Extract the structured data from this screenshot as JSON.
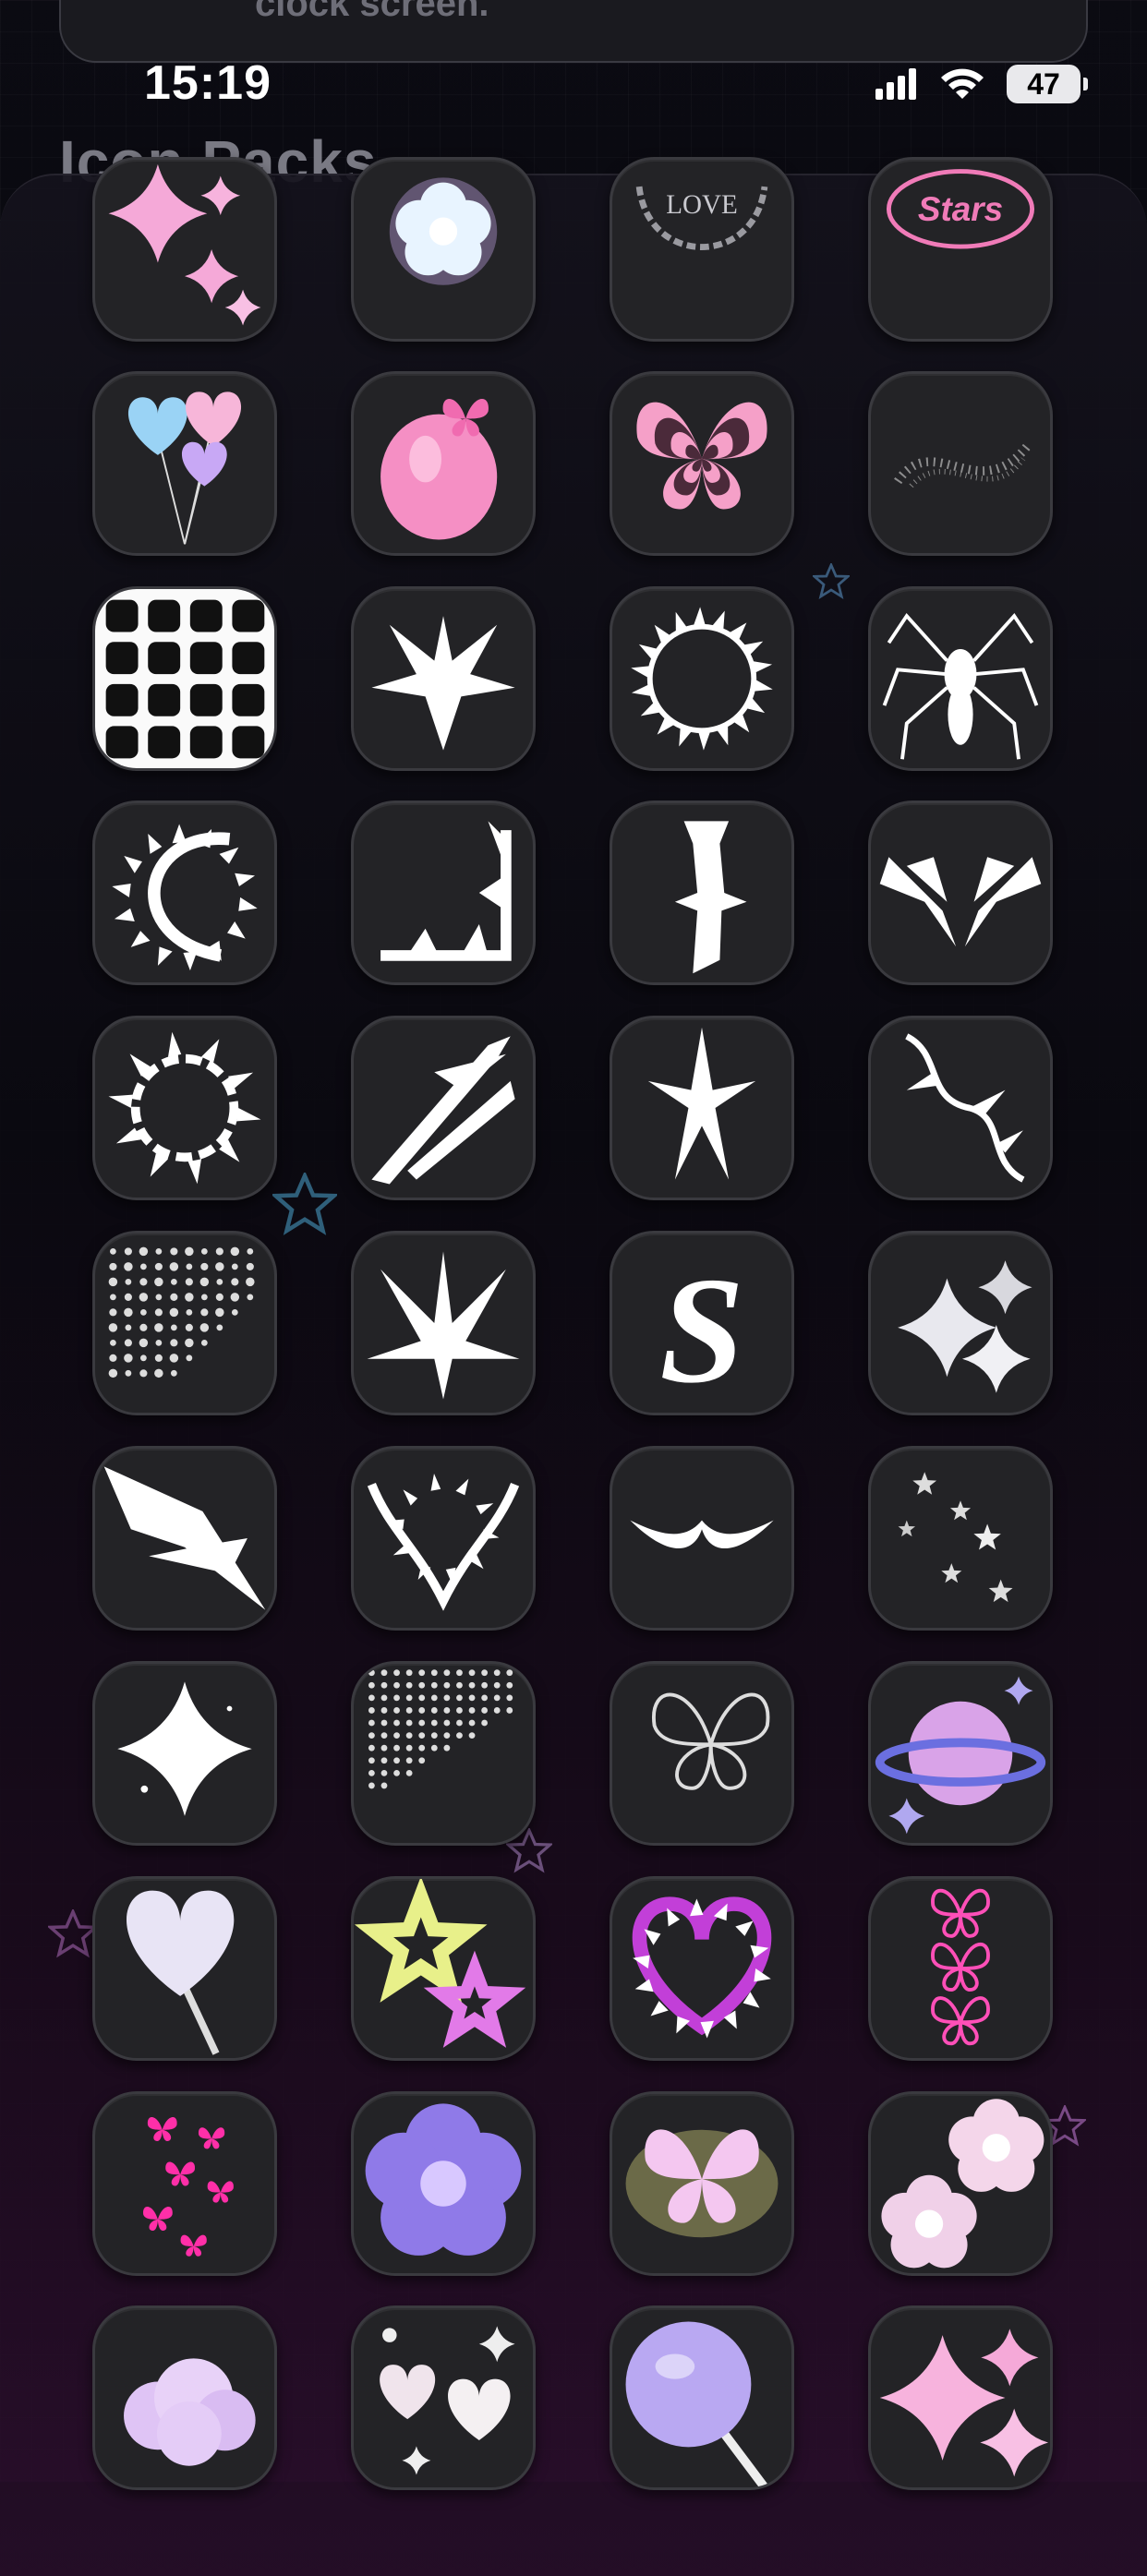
{
  "banner": {
    "text": "clock screen."
  },
  "status_bar": {
    "time": "15:19",
    "battery": "47"
  },
  "page": {
    "title": "Icon Packs"
  },
  "icons": [
    "pink-sparkles-icon",
    "glowing-flower-icon",
    "chain-heart-love-icon",
    "stars-logo-icon",
    "heart-balloons-icon",
    "pink-strawberry-icon",
    "neon-butterfly-icon",
    "glitter-swirl-icon",
    "app-grid-icon",
    "tribal-heart-icon",
    "thorn-ring-icon",
    "spider-icon",
    "thorn-crescent-icon",
    "thorn-corner-icon",
    "gothic-letter-e-icon",
    "tribal-wings-icon",
    "tribal-circle-icon",
    "tribal-claw-icon",
    "tribal-flame-icon",
    "thorn-vine-icon",
    "halftone-star-icon",
    "tribal-spikes-icon",
    "graffiti-s-icon",
    "silver-sparkles-icon",
    "tribal-blade-icon",
    "tribal-horns-icon",
    "tribal-mustache-icon",
    "falling-stars-icon",
    "sparkle-cross-icon",
    "glitter-drip-icon",
    "xray-butterfly-icon",
    "purple-planet-icon",
    "heart-lollipop-icon",
    "neon-stars-icon",
    "purple-flame-heart-icon",
    "neon-butterflies-icon",
    "pink-butterflies-icon",
    "chrome-flower-icon",
    "glowing-butterfly-icon",
    "pastel-flowers-icon",
    "pastel-cloud-icon",
    "pastel-hearts-icon",
    "lollipop-icon",
    "pink-stars-icon"
  ]
}
